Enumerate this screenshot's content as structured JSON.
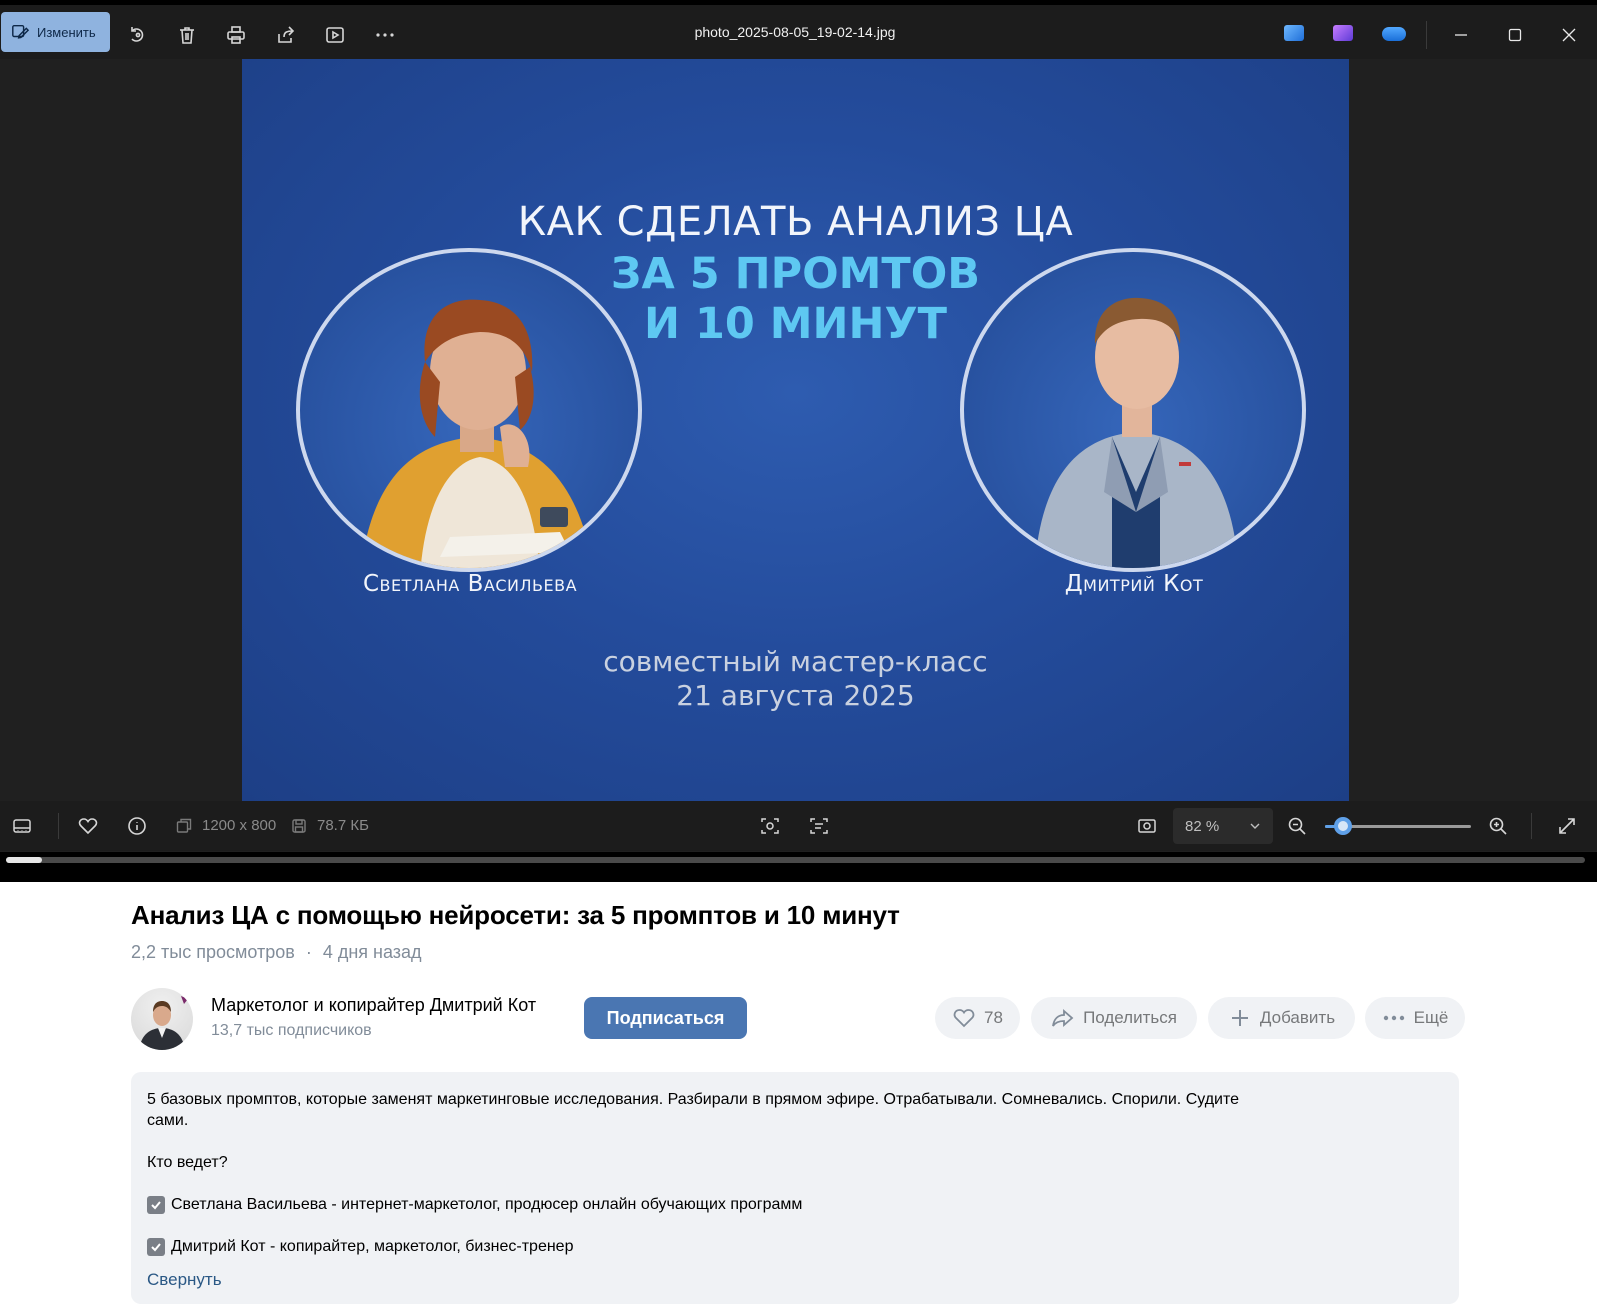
{
  "viewer": {
    "edit_label": "Изменить",
    "file_name": "photo_2025-08-05_19-02-14.jpg",
    "dimensions": "1200 x 800",
    "file_size": "78.7 КБ",
    "zoom_value": "82 %",
    "zoom_fraction": 0.12,
    "accent_color": "#5fa0e8"
  },
  "slide": {
    "title_line_1": "КАК СДЕЛАТЬ АНАЛИЗ ЦА",
    "title_line_2": "ЗА 5 ПРОМТОВ",
    "title_line_3": "И 10 МИНУТ",
    "speaker_left": "Светлана Васильева",
    "speaker_right": "Дмитрий Кот",
    "subtitle_line_1": "совместный мастер-класс",
    "subtitle_line_2": "21 августа 2025"
  },
  "player": {
    "progress_fraction": 0.023
  },
  "video": {
    "title": "Анализ ЦА с помощью нейросети: за 5 промптов и 10 минут",
    "views": "2,2 тыс просмотров",
    "separator": "·",
    "posted": "4 дня назад"
  },
  "channel": {
    "name": "Маркетолог и копирайтер Дмитрий Кот",
    "subscribers": "13,7 тыс подписчиков",
    "subscribe_label": "Подписаться"
  },
  "actions": {
    "likes": "78",
    "share_label": "Поделиться",
    "add_label": "Добавить",
    "more_label": "Ещё"
  },
  "description": {
    "lines": [
      "5 базовых промптов, которые заменят маркетинговые исследования. Разбирали в прямом эфире. Отрабатывали. Сомневались. Спорили. Судите",
      "сами.",
      "Кто ведет?",
      "Светлана Васильева - интернет-маркетолог, продюсер онлайн обучающих программ",
      "Дмитрий Кот - копирайтер, маркетолог, бизнес-тренер"
    ],
    "collapse_label": "Свернуть"
  }
}
